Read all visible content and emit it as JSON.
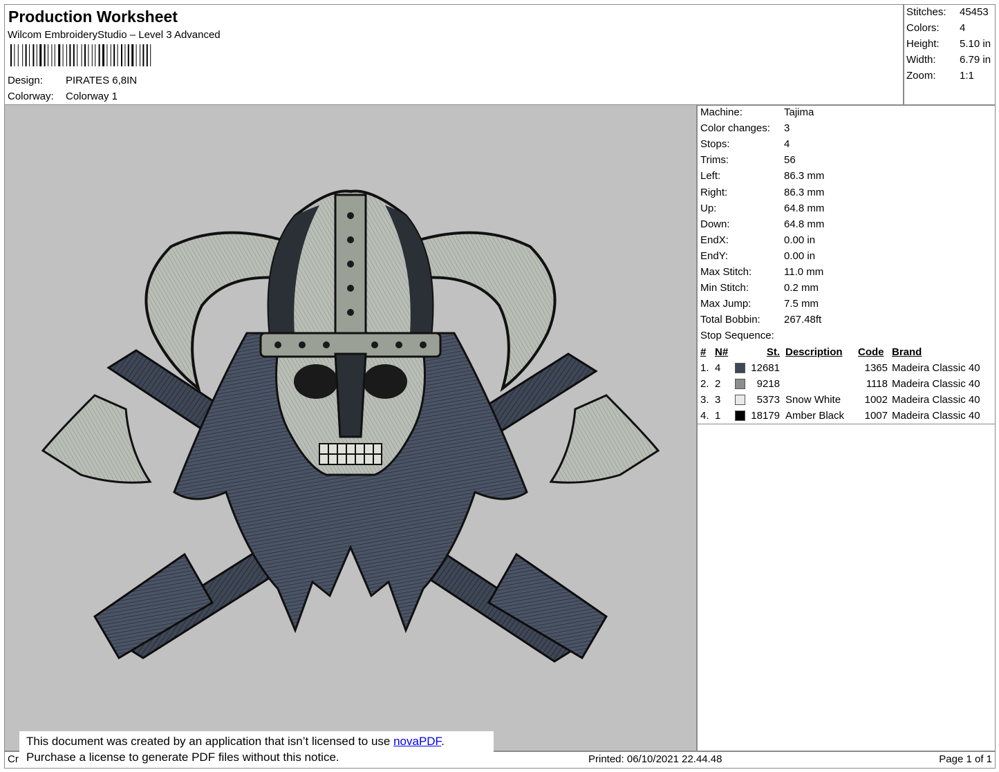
{
  "header": {
    "title": "Production Worksheet",
    "software": "Wilcom EmbroideryStudio – Level 3 Advanced",
    "design_label": "Design:",
    "design_value": "PIRATES 6,8IN",
    "colorway_label": "Colorway:",
    "colorway_value": "Colorway 1"
  },
  "stats": [
    {
      "label": "Stitches:",
      "value": "45453"
    },
    {
      "label": "Colors:",
      "value": "4"
    },
    {
      "label": "Height:",
      "value": "5.10 in"
    },
    {
      "label": "Width:",
      "value": "6.79 in"
    },
    {
      "label": "Zoom:",
      "value": "1:1"
    }
  ],
  "machine_info": [
    {
      "label": "Machine:",
      "value": "Tajima"
    },
    {
      "label": "Color changes:",
      "value": "3"
    },
    {
      "label": "Stops:",
      "value": "4"
    },
    {
      "label": "Trims:",
      "value": "56"
    },
    {
      "label": "Left:",
      "value": "86.3 mm"
    },
    {
      "label": "Right:",
      "value": "86.3 mm"
    },
    {
      "label": "Up:",
      "value": "64.8 mm"
    },
    {
      "label": "Down:",
      "value": "64.8 mm"
    },
    {
      "label": "EndX:",
      "value": "0.00 in"
    },
    {
      "label": "EndY:",
      "value": "0.00 in"
    },
    {
      "label": "Max Stitch:",
      "value": "11.0 mm"
    },
    {
      "label": "Min Stitch:",
      "value": "0.2 mm"
    },
    {
      "label": "Max Jump:",
      "value": "7.5 mm"
    },
    {
      "label": "Total Bobbin:",
      "value": "267.48ft"
    }
  ],
  "stop_sequence": {
    "label": "Stop Sequence:",
    "headers": {
      "num": "#",
      "n": "N#",
      "st": "St.",
      "description": "Description",
      "code": "Code",
      "brand": "Brand"
    },
    "rows": [
      {
        "num": "1.",
        "n": "4",
        "color": "#3f4756",
        "st": "12681",
        "description": "",
        "code": "1365",
        "brand": "Madeira Classic 40"
      },
      {
        "num": "2.",
        "n": "2",
        "color": "#8a8e8d",
        "st": "9218",
        "description": "",
        "code": "1118",
        "brand": "Madeira Classic 40"
      },
      {
        "num": "3.",
        "n": "3",
        "color": "#e8e8ee",
        "st": "5373",
        "description": "Snow White",
        "code": "1002",
        "brand": "Madeira Classic 40"
      },
      {
        "num": "4.",
        "n": "1",
        "color": "#000000",
        "st": "18179",
        "description": "Amber Black",
        "code": "1007",
        "brand": "Madeira Classic 40"
      }
    ]
  },
  "footer": {
    "created_fragment": "Cr",
    "printed": "Printed: 06/10/2021 22.44.48",
    "page": "Page 1 of 1"
  },
  "notice": {
    "line1_text": "This document was created by an application that isn’t licensed to use ",
    "link_text": "novaPDF",
    "line1_end": ".",
    "line2": "Purchase a license to generate PDF files without this notice."
  },
  "colors": {
    "preview_bg": "#c1c1c1",
    "thread_dark_blue_gray": "#3f4756",
    "thread_gray": "#8a8e8d",
    "thread_snow_white": "#e8e8ee",
    "thread_black": "#000000",
    "link": "#0000ee"
  }
}
